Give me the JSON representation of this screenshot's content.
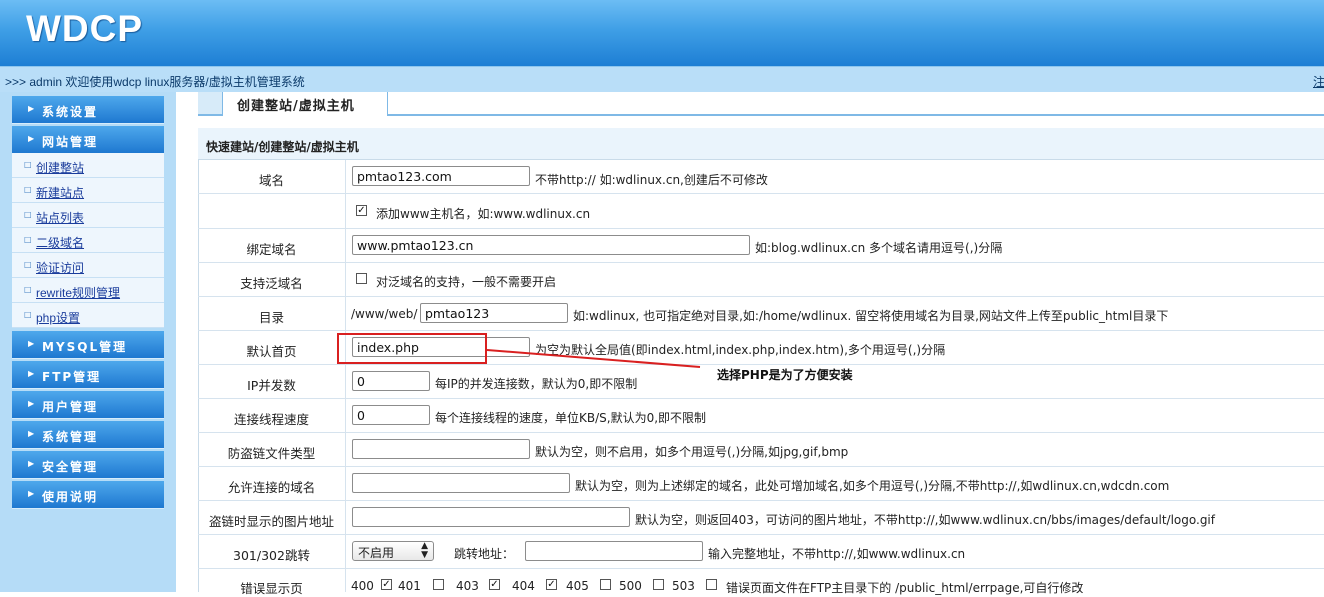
{
  "header": {
    "logo": "WDCP"
  },
  "welcome": {
    "text": ">>> admin 欢迎使用wdcp linux服务器/虚拟主机管理系统",
    "logout": "注"
  },
  "sidebar": {
    "menus": [
      {
        "label": "系统设置"
      },
      {
        "label": "网站管理"
      },
      {
        "label": "MYSQL管理"
      },
      {
        "label": "FTP管理"
      },
      {
        "label": "用户管理"
      },
      {
        "label": "系统管理"
      },
      {
        "label": "安全管理"
      },
      {
        "label": "使用说明"
      }
    ],
    "site_items": [
      {
        "label": "创建整站"
      },
      {
        "label": "新建站点"
      },
      {
        "label": "站点列表"
      },
      {
        "label": "二级域名"
      },
      {
        "label": "验证访问"
      },
      {
        "label": "rewrite规则管理"
      },
      {
        "label": "php设置"
      }
    ]
  },
  "main": {
    "tab": "创建整站/虚拟主机",
    "form_title": "快速建站/创建整站/虚拟主机",
    "domain": {
      "label": "域名",
      "value": "pmtao123.com",
      "hint": "不带http:// 如:wdlinux.cn,创建后不可修改"
    },
    "add_www": {
      "checked": true,
      "label": "添加www主机名，如:www.wdlinux.cn"
    },
    "bind": {
      "label": "绑定域名",
      "value": "www.pmtao123.cn",
      "hint": "如:blog.wdlinux.cn 多个域名请用逗号(,)分隔"
    },
    "wildcard": {
      "label": "支持泛域名",
      "checked": false,
      "hint": "对泛域名的支持，一般不需要开启"
    },
    "dir": {
      "label": "目录",
      "prefix": "/www/web/",
      "value": "pmtao123",
      "hint": "如:wdlinux, 也可指定绝对目录,如:/home/wdlinux. 留空将使用域名为目录,网站文件上传至public_html目录下"
    },
    "index": {
      "label": "默认首页",
      "value": "index.php",
      "hint": "为空为默认全局值(即index.html,index.php,index.htm),多个用逗号(,)分隔"
    },
    "ip_conn": {
      "label": "IP并发数",
      "value": "0",
      "hint": "每IP的并发连接数，默认为0,即不限制"
    },
    "speed": {
      "label": "连接线程速度",
      "value": "0",
      "hint": "每个连接线程的速度，单位KB/S,默认为0,即不限制"
    },
    "hotlink_types": {
      "label": "防盗链文件类型",
      "value": "",
      "hint": "默认为空，则不启用，如多个用逗号(,)分隔,如jpg,gif,bmp"
    },
    "allowed_domains": {
      "label": "允许连接的域名",
      "value": "",
      "hint": "默认为空，则为上述绑定的域名，此处可增加域名,如多个用逗号(,)分隔,不带http://,如wdlinux.cn,wdcdn.com"
    },
    "hotlink_image": {
      "label": "盗链时显示的图片地址",
      "value": "",
      "hint": "默认为空，则返回403，可访问的图片地址，不带http://,如www.wdlinux.cn/bbs/images/default/logo.gif"
    },
    "redirect": {
      "label": "301/302跳转",
      "select": "不启用",
      "addr_label": "跳转地址：",
      "value": "",
      "hint": "输入完整地址，不带http://,如www.wdlinux.cn"
    },
    "errors": {
      "label": "错误显示页",
      "codes": [
        {
          "code": "400",
          "checked": true
        },
        {
          "code": "401",
          "checked": false
        },
        {
          "code": "403",
          "checked": true
        },
        {
          "code": "404",
          "checked": true
        },
        {
          "code": "405",
          "checked": false
        },
        {
          "code": "500",
          "checked": false
        },
        {
          "code": "503",
          "checked": false
        }
      ],
      "hint": "错误页面文件在FTP主目录下的 /public_html/errpage,可自行修改"
    }
  },
  "annotation": {
    "text": "选择PHP是为了方便安装",
    "color": "#d92020"
  }
}
